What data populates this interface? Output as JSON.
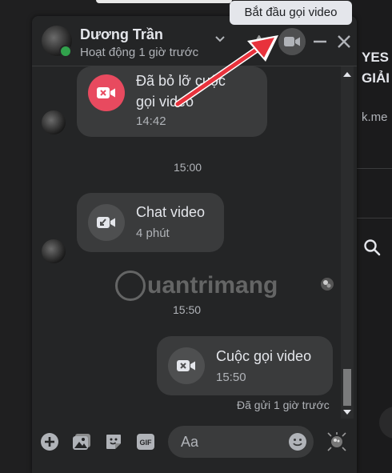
{
  "tooltip": "Bắt đầu gọi video",
  "header": {
    "name": "Dương Trần",
    "status": "Hoạt động 1 giờ trước"
  },
  "messages": {
    "missed": {
      "title_line1": "Đã bỏ lỡ cuộc",
      "title_line2": "gọi video",
      "time": "14:42"
    },
    "separator1": "15:00",
    "chat_video": {
      "title": "Chat video",
      "duration": "4 phút"
    },
    "separator2": "15:50",
    "outgoing": {
      "title": "Cuộc gọi video",
      "time": "15:50"
    },
    "sent_status": "Đã gửi 1 giờ trước"
  },
  "composer": {
    "placeholder": "Aa"
  },
  "watermark": "uantrimang",
  "background_page": {
    "line1": "YES N",
    "line2": "GIẢI",
    "line3": "k.me"
  },
  "colors": {
    "accent": "#e84a5f",
    "annotation_arrow": "#e8323c",
    "online": "#31a24c"
  },
  "icons": [
    "phone-icon",
    "video-camera-icon",
    "minimize-icon",
    "close-icon",
    "plus-icon",
    "image-icon",
    "sticker-icon",
    "gif-icon",
    "emoji-icon",
    "sticker-character-icon",
    "search-icon"
  ]
}
